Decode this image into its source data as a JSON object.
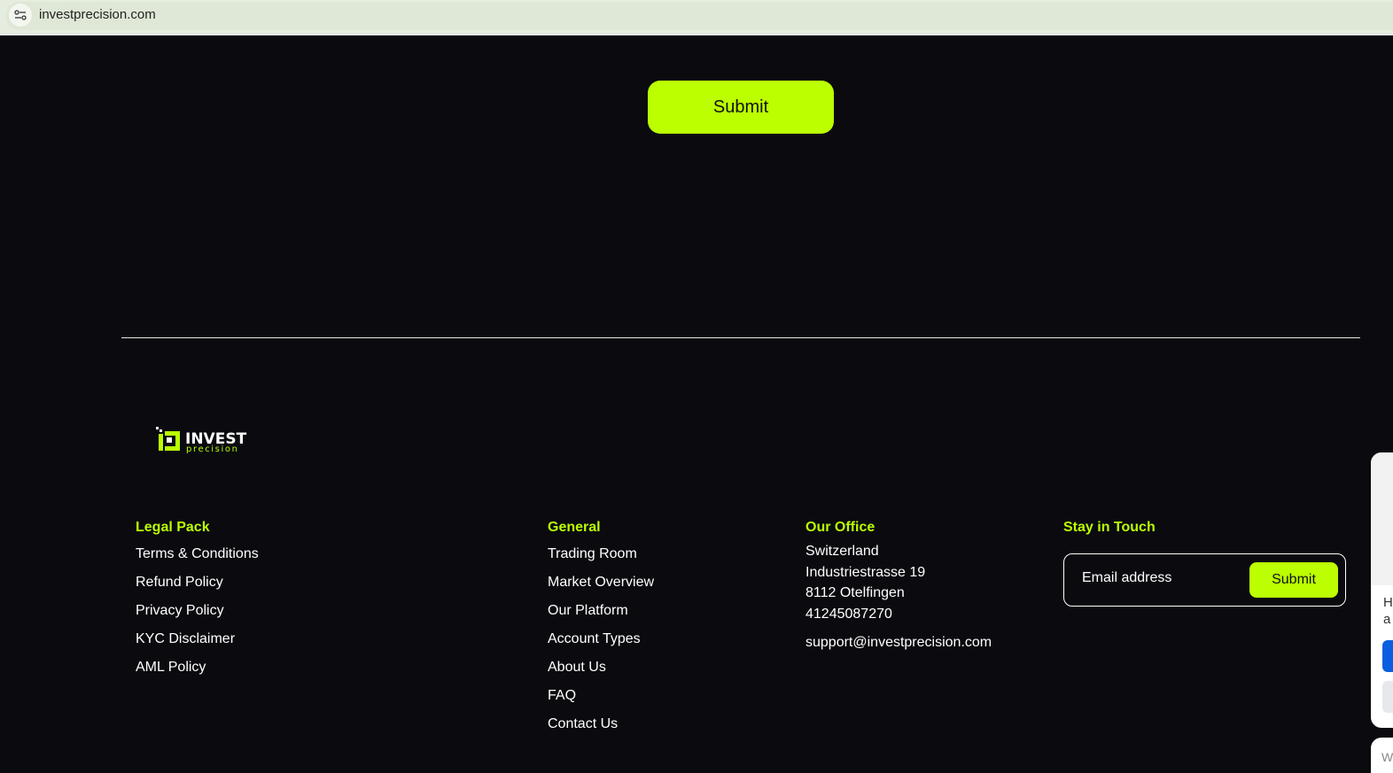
{
  "browser": {
    "url": "investprecision.com"
  },
  "form": {
    "submit_label": "Submit"
  },
  "footer": {
    "logo": {
      "word1": "INVEST",
      "word2": "precision"
    },
    "legal": {
      "title": "Legal Pack",
      "items": [
        "Terms & Conditions",
        "Refund Policy",
        "Privacy Policy",
        "KYC Disclaimer",
        "AML Policy"
      ]
    },
    "general": {
      "title": "General",
      "items": [
        "Trading Room",
        "Market Overview",
        "Our Platform",
        "Account Types",
        "About Us",
        "FAQ",
        "Contact Us"
      ]
    },
    "office": {
      "title": "Our Office",
      "country": "Switzerland",
      "street": "Industriestrasse 19",
      "city": "8112 Otelfingen",
      "phone": "41245087270",
      "email": "support@investprecision.com"
    },
    "newsletter": {
      "title": "Stay in Touch",
      "placeholder": "Email address",
      "submit_label": "Submit"
    }
  },
  "popup": {
    "line1": "H",
    "line2": "a",
    "bottom": "W"
  },
  "colors": {
    "accent": "#bbff00",
    "background": "#0a0a0f"
  }
}
